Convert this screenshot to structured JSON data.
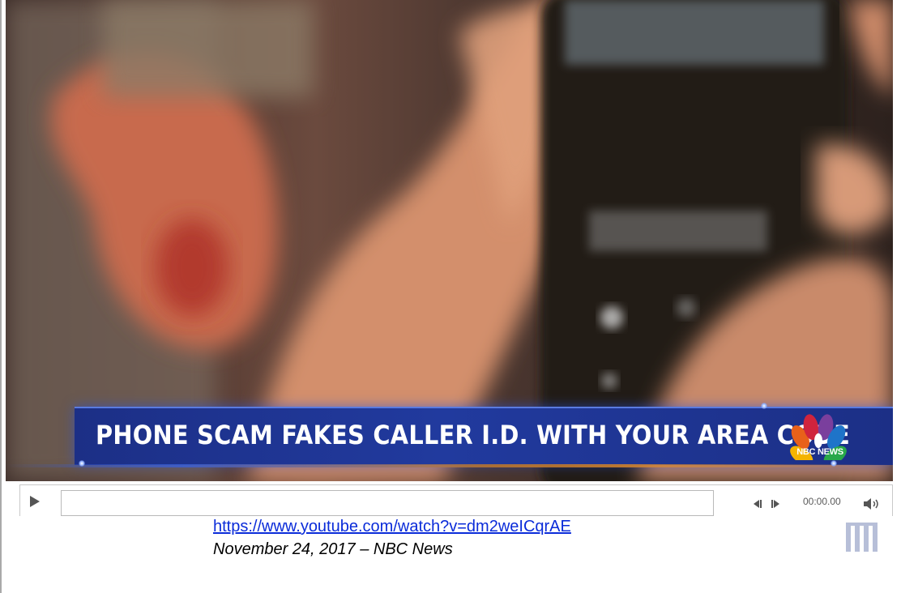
{
  "video": {
    "headline": "PHONE SCAM FAKES CALLER I.D. WITH YOUR AREA CODE",
    "network": "NBC NEWS"
  },
  "player": {
    "play_icon": "play-icon",
    "prev_icon": "previous-frame-icon",
    "next_icon": "next-frame-icon",
    "volume_icon": "volume-icon",
    "time": "00:00.00"
  },
  "caption": {
    "link_text": "https://www.youtube.com/watch?v=dm2weICqrAE",
    "link_href": "https://www.youtube.com/watch?v=dm2weICqrAE",
    "date_source": "November 24, 2017 – NBC News"
  },
  "colors": {
    "banner": "#213a9e",
    "link": "#0b2cd9",
    "logo": "#b7bfd8"
  }
}
